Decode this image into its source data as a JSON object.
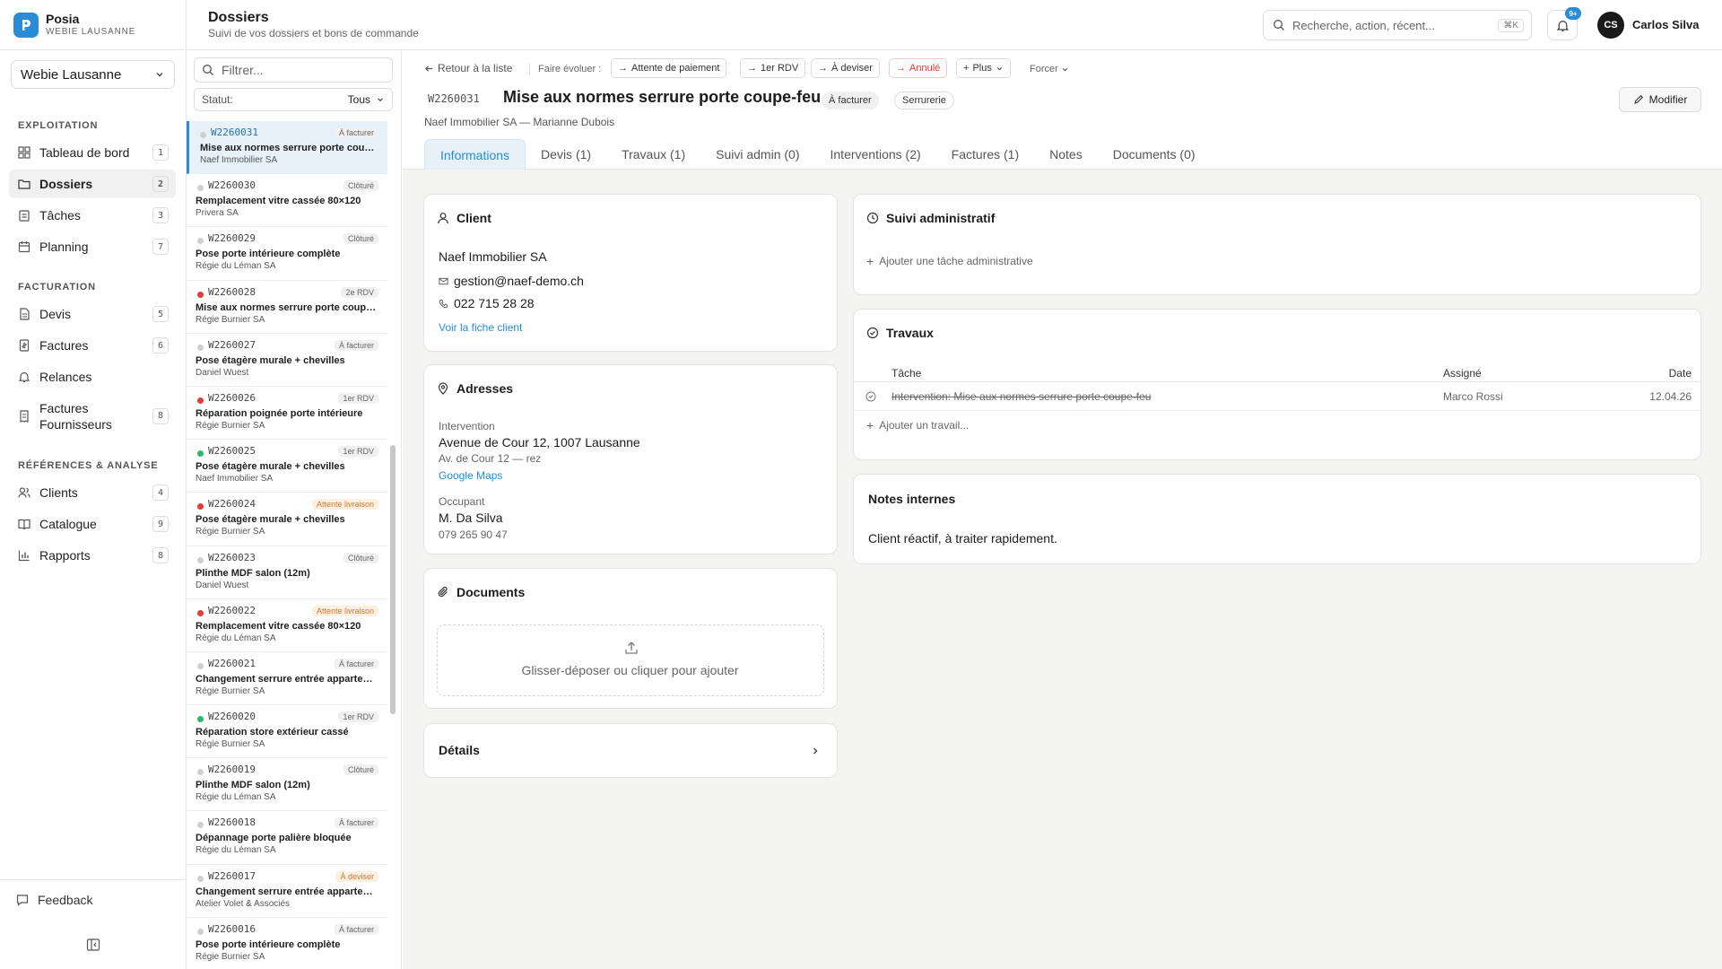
{
  "brand": {
    "name": "Posia",
    "sub": "WEBIE LAUSANNE",
    "logo_icon": "posia-logo"
  },
  "org_select": {
    "value": "Webie Lausanne"
  },
  "nav": {
    "sections": {
      "exploitation": "EXPLOITATION",
      "facturation": "FACTURATION",
      "references": "RÉFÉRENCES & ANALYSE"
    },
    "items": [
      {
        "label": "Tableau de bord",
        "key": "1",
        "icon": "dashboard-icon"
      },
      {
        "label": "Dossiers",
        "key": "2",
        "icon": "folder-icon"
      },
      {
        "label": "Tâches",
        "key": "3",
        "icon": "clipboard-icon"
      },
      {
        "label": "Planning",
        "key": "7",
        "icon": "calendar-icon"
      },
      {
        "label": "Devis",
        "key": "5",
        "icon": "document-icon"
      },
      {
        "label": "Factures",
        "key": "6",
        "icon": "invoice-icon"
      },
      {
        "label": "Relances",
        "key": "",
        "icon": "bell-ring-icon"
      },
      {
        "label": "Factures Fournisseurs",
        "key": "8",
        "icon": "receipt-icon"
      },
      {
        "label": "Clients",
        "key": "4",
        "icon": "users-icon"
      },
      {
        "label": "Catalogue",
        "key": "9",
        "icon": "book-icon"
      },
      {
        "label": "Rapports",
        "key": "8",
        "icon": "bar-chart-icon"
      }
    ]
  },
  "feedback": {
    "label": "Feedback"
  },
  "header": {
    "title": "Dossiers",
    "subtitle": "Suivi de vos dossiers et bons de commande",
    "search_placeholder": "Recherche, action, récent...",
    "search_kbd": "⌘K",
    "notif_badge": "9+",
    "user_initials": "CS",
    "user_name": "Carlos Silva"
  },
  "list": {
    "filter_placeholder": "Filtrer...",
    "status_label": "Statut:",
    "status_value": "Tous",
    "rows": [
      {
        "num": "W2260031",
        "badge": "À facturer",
        "title": "Mise aux normes serrure porte coupe-feu",
        "client": "Naef Immobilier SA",
        "dot": "grey",
        "warn": false,
        "selected": true
      },
      {
        "num": "W2260030",
        "badge": "Clôturé",
        "title": "Remplacement vitre cassée 80×120",
        "client": "Privera SA",
        "dot": "grey",
        "warn": false
      },
      {
        "num": "W2260029",
        "badge": "Clôturé",
        "title": "Pose porte intérieure complète",
        "client": "Régie du Léman SA",
        "dot": "grey",
        "warn": false
      },
      {
        "num": "W2260028",
        "badge": "2e RDV",
        "title": "Mise aux normes serrure porte coupe-feu",
        "client": "Régie Burnier SA",
        "dot": "red",
        "warn": false
      },
      {
        "num": "W2260027",
        "badge": "À facturer",
        "title": "Pose étagère murale + chevilles",
        "client": "Daniel Wuest",
        "dot": "grey",
        "warn": false
      },
      {
        "num": "W2260026",
        "badge": "1er RDV",
        "title": "Réparation poignée porte intérieure",
        "client": "Régie Burnier SA",
        "dot": "red",
        "warn": false
      },
      {
        "num": "W2260025",
        "badge": "1er RDV",
        "title": "Pose étagère murale + chevilles",
        "client": "Naef Immobilier SA",
        "dot": "green",
        "warn": false
      },
      {
        "num": "W2260024",
        "badge": "Attente livraison",
        "title": "Pose étagère murale + chevilles",
        "client": "Régie Burnier SA",
        "dot": "red",
        "warn": true
      },
      {
        "num": "W2260023",
        "badge": "Clôturé",
        "title": "Plinthe MDF salon (12m)",
        "client": "Daniel Wuest",
        "dot": "grey",
        "warn": false
      },
      {
        "num": "W2260022",
        "badge": "Attente livraison",
        "title": "Remplacement vitre cassée 80×120",
        "client": "Régie du Léman SA",
        "dot": "red",
        "warn": true
      },
      {
        "num": "W2260021",
        "badge": "À facturer",
        "title": "Changement serrure entrée appartement",
        "client": "Régie Burnier SA",
        "dot": "grey",
        "warn": false
      },
      {
        "num": "W2260020",
        "badge": "1er RDV",
        "title": "Réparation store extérieur cassé",
        "client": "Régie Burnier SA",
        "dot": "green",
        "warn": false
      },
      {
        "num": "W2260019",
        "badge": "Clôturé",
        "title": "Plinthe MDF salon (12m)",
        "client": "Régie du Léman SA",
        "dot": "grey",
        "warn": false
      },
      {
        "num": "W2260018",
        "badge": "À facturer",
        "title": "Dépannage porte palière bloquée",
        "client": "Régie du Léman SA",
        "dot": "grey",
        "warn": false
      },
      {
        "num": "W2260017",
        "badge": "À deviser",
        "title": "Changement serrure entrée appartement",
        "client": "Atelier Volet & Associés",
        "dot": "grey",
        "warn": true
      },
      {
        "num": "W2260016",
        "badge": "À facturer",
        "title": "Pose porte intérieure complète",
        "client": "Régie Burnier SA",
        "dot": "grey",
        "warn": false
      }
    ]
  },
  "detail": {
    "back": "Retour à la liste",
    "evolve_label": "Faire évoluer :",
    "actions": [
      "Attente de paiement",
      "1er RDV",
      "À deviser",
      "Annulé"
    ],
    "more": "Plus",
    "force": "Forcer",
    "num": "W2260031",
    "title": "Mise aux normes serrure porte coupe-feu",
    "tags": [
      "À facturer",
      "Serrurerie"
    ],
    "subtitle": "Naef Immobilier SA — Marianne Dubois",
    "edit": "Modifier",
    "tabs": [
      "Informations",
      "Devis (1)",
      "Travaux (1)",
      "Suivi admin (0)",
      "Interventions (2)",
      "Factures (1)",
      "Notes",
      "Documents (0)"
    ],
    "client": {
      "title": "Client",
      "name": "Naef Immobilier SA",
      "email": "gestion@naef-demo.ch",
      "phone": "022 715 28 28",
      "link": "Voir la fiche client"
    },
    "addresses": {
      "title": "Adresses",
      "intervention_label": "Intervention",
      "street": "Avenue de Cour 12, 1007 Lausanne",
      "line2": "Av. de Cour 12 — rez",
      "maps": "Google Maps",
      "occupant_label": "Occupant",
      "occupant": "M. Da Silva",
      "occupant_phone": "079 265 90 47"
    },
    "documents": {
      "title": "Documents",
      "drop": "Glisser-déposer ou cliquer pour ajouter"
    },
    "details": {
      "title": "Détails"
    },
    "admin": {
      "title": "Suivi administratif",
      "add": "Ajouter une tâche administrative"
    },
    "travaux": {
      "title": "Travaux",
      "headers": [
        "Tâche",
        "Assigné",
        "Date"
      ],
      "row": {
        "task": "Intervention: Mise aux normes serrure porte coupe-feu",
        "assignee": "Marco Rossi",
        "date": "12.04.26"
      },
      "add": "Ajouter un travail..."
    },
    "notes": {
      "title": "Notes internes",
      "text": "Client réactif, à traiter rapidement."
    }
  },
  "colors": {
    "accent": "#2a8bd6",
    "danger": "#d63a2f",
    "warning": "#d07a2b",
    "success": "#2bb673"
  }
}
